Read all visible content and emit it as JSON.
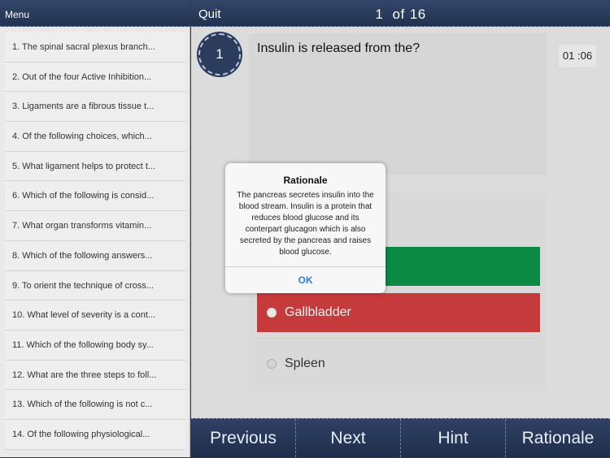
{
  "sidebar": {
    "menu_label": "Menu",
    "questions": [
      "1. The spinal sacral plexus branch...",
      "2. Out of the four Active Inhibition...",
      "3. Ligaments are a fibrous tissue t...",
      "4. Of the following choices, which...",
      "5. What ligament helps to protect t...",
      "6. Which of the following is consid...",
      "7. What organ transforms vitamin...",
      "8. Which of the following answers...",
      "9. To orient the technique of cross...",
      "10. What level of severity is a cont...",
      "11. Which of the following body sy...",
      "12. What are the three steps to foll...",
      "13. Which of the following is not c...",
      "14. Of the following physiological..."
    ]
  },
  "topbar": {
    "quit_label": "Quit",
    "current": "1",
    "of_label": "of",
    "total": "16"
  },
  "question": {
    "number": "1",
    "text": "Insulin is released from the?",
    "timer": "01 :06"
  },
  "answers": {
    "wrong": "Gallbladder",
    "plain": "Spleen"
  },
  "bottombar": {
    "previous": "Previous",
    "next": "Next",
    "hint": "Hint",
    "rationale": "Rationale"
  },
  "dialog": {
    "title": "Rationale",
    "body": "The pancreas secretes insulin into the blood stream. Insulin is a protein that reduces blood glucose and its conterpart glucagon which is also secreted by the pancreas and raises blood glucose.",
    "ok_label": "OK"
  },
  "colors": {
    "navbar": "#2a3a55",
    "correct": "#0b8a45",
    "wrong": "#c53a3a",
    "link": "#2d7fe0"
  }
}
